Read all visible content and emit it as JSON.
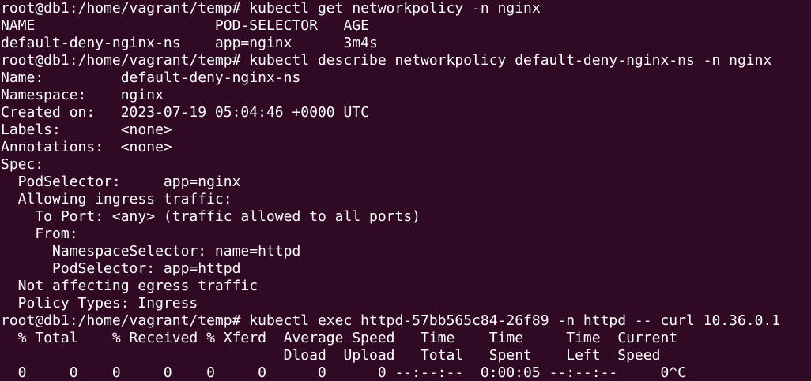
{
  "terminal": {
    "lines": [
      "root@db1:/home/vagrant/temp# kubectl get networkpolicy -n nginx",
      "NAME                     POD-SELECTOR   AGE",
      "default-deny-nginx-ns    app=nginx      3m4s",
      "root@db1:/home/vagrant/temp# kubectl describe networkpolicy default-deny-nginx-ns -n nginx",
      "Name:         default-deny-nginx-ns",
      "Namespace:    nginx",
      "Created on:   2023-07-19 05:04:46 +0000 UTC",
      "Labels:       <none>",
      "Annotations:  <none>",
      "Spec:",
      "  PodSelector:     app=nginx",
      "  Allowing ingress traffic:",
      "    To Port: <any> (traffic allowed to all ports)",
      "    From:",
      "      NamespaceSelector: name=httpd",
      "      PodSelector: app=httpd",
      "  Not affecting egress traffic",
      "  Policy Types: Ingress",
      "root@db1:/home/vagrant/temp# kubectl exec httpd-57bb565c84-26f89 -n httpd -- curl 10.36.0.1",
      "  % Total    % Received % Xferd  Average Speed   Time    Time     Time  Current",
      "                                 Dload  Upload   Total   Spent    Left  Speed",
      "  0     0    0     0    0     0      0      0 --:--:--  0:00:05 --:--:--     0^C"
    ]
  },
  "colors": {
    "background": "#300a24",
    "foreground": "#ffffff"
  }
}
